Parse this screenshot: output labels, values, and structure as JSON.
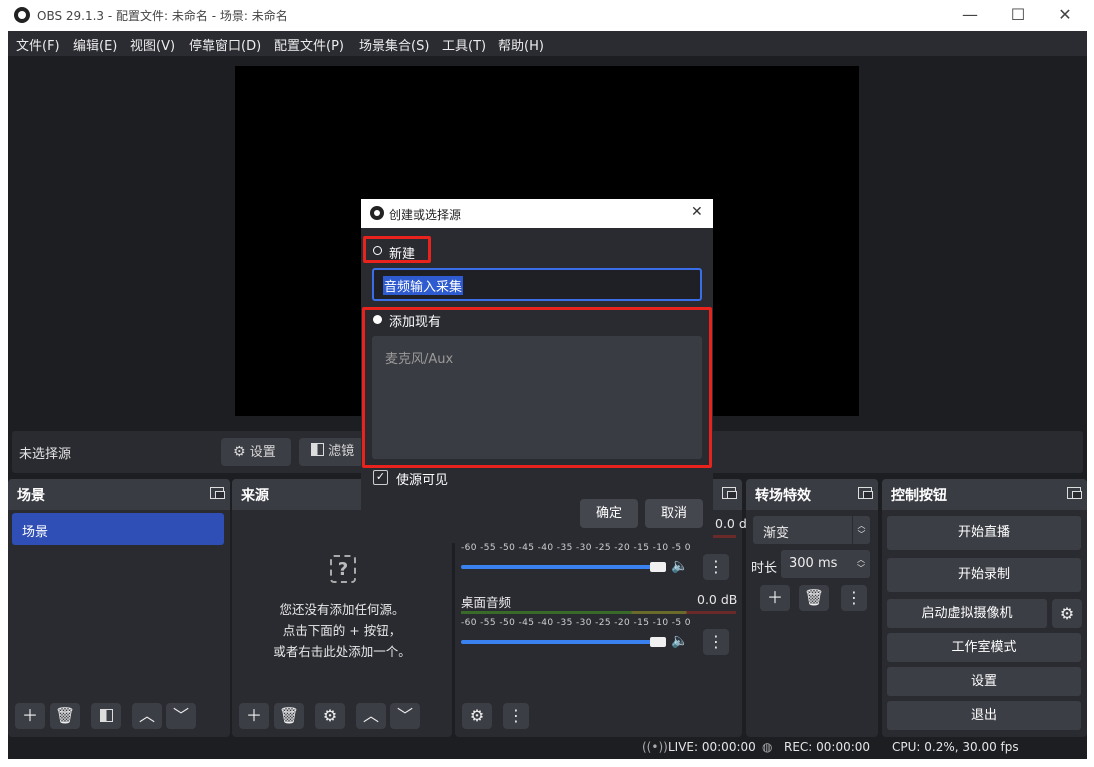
{
  "window": {
    "title": "OBS 29.1.3 - 配置文件: 未命名 - 场景: 未命名",
    "minimize_icon": "—",
    "maximize_icon": "☐",
    "close_icon": "✕"
  },
  "menu": [
    {
      "label": "文件(F)"
    },
    {
      "label": "编辑(E)"
    },
    {
      "label": "视图(V)"
    },
    {
      "label": "停靠窗口(D)"
    },
    {
      "label": "配置文件(P)"
    },
    {
      "label": "场景集合(S)"
    },
    {
      "label": "工具(T)"
    },
    {
      "label": "帮助(H)"
    }
  ],
  "context_bar": {
    "no_source": "未选择源",
    "settings": "设置",
    "filters": "滤镜"
  },
  "scenes_dock": {
    "title": "场景",
    "items": [
      "场景"
    ]
  },
  "sources_dock": {
    "title": "来源",
    "empty_line1": "您还没有添加任何源。",
    "empty_line2": "点击下面的 + 按钮，",
    "empty_line3": "或者右击此处添加一个。"
  },
  "mixer_dock": {
    "track1_db": "0.0 dB",
    "track1_level": 0.7,
    "track2_name": "桌面音频",
    "track2_db": "0.0 dB",
    "track2_level": 0.7,
    "scale": "-60 -55 -50 -45 -40 -35 -30 -25 -20 -15 -10 -5 0"
  },
  "transitions_dock": {
    "title": "转场特效",
    "transition": "渐变",
    "duration_label": "时长",
    "duration_value": "300 ms"
  },
  "controls_dock": {
    "title": "控制按钮",
    "start_stream": "开始直播",
    "start_record": "开始录制",
    "virtual_cam": "启动虚拟摄像机",
    "studio_mode": "工作室模式",
    "settings": "设置",
    "exit": "退出"
  },
  "status_bar": {
    "live": "LIVE: 00:00:00",
    "rec": "REC: 00:00:00",
    "cpu": "CPU: 0.2%, 30.00 fps"
  },
  "dialog": {
    "title": "创建或选择源",
    "close_icon": "✕",
    "option_new": "新建",
    "new_name_value": "音频输入采集",
    "option_existing": "添加现有",
    "existing_items": [
      "麦克风/Aux"
    ],
    "visible_checkbox": "使源可见",
    "ok": "确定",
    "cancel": "取消"
  },
  "colors": {
    "accent": "#2f4fb7",
    "highlight_box": "#e8231e",
    "input_border": "#3a6ee8"
  }
}
